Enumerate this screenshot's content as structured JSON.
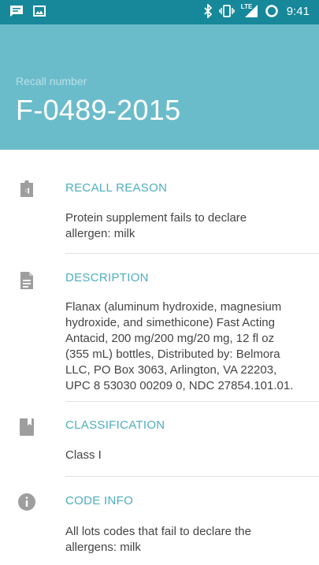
{
  "status_bar": {
    "time": "9:41",
    "icons": [
      "chat-icon",
      "image-icon",
      "bluetooth-icon",
      "vibrate-icon",
      "lte-signal-icon",
      "sync-icon"
    ],
    "network_label": "LTE"
  },
  "header": {
    "label": "Recall number",
    "recall_number": "F-0489-2015",
    "color": "#6bbccb"
  },
  "sections": [
    {
      "title": "RECALL REASON",
      "icon": "clipboard-arrow-icon",
      "body": "Protein supplement fails to declare allergen: milk"
    },
    {
      "title": "DESCRIPTION",
      "icon": "document-icon",
      "body": "Flanax (aluminum hydroxide, magnesium hydroxide, and simethicone) Fast Acting Antacid, 200 mg/200 mg/20 mg, 12 fl oz (355 mL) bottles, Distributed by: Belmora LLC, PO Box 3063, Arlington, VA 22203, UPC 8 53030 00209 0, NDC 27854.101.01."
    },
    {
      "title": "CLASSIFICATION",
      "icon": "book-icon",
      "body": "Class I"
    },
    {
      "title": "CODE INFO",
      "icon": "info-icon",
      "body": "All lots codes that fail to declare the allergens: milk"
    }
  ],
  "colors": {
    "status_bar": "#16889a",
    "accent": "#4eaec0",
    "icon": "#9e9e9e"
  }
}
